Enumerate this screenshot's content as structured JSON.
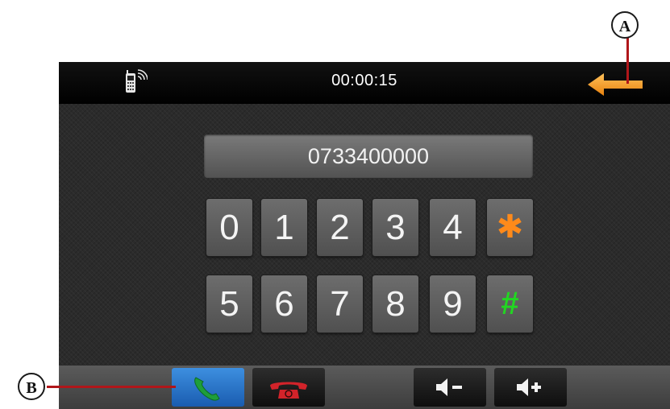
{
  "status_bar": {
    "call_timer": "00:00:15",
    "phone_icon": "phone-signal-icon",
    "back_icon": "back-arrow-icon"
  },
  "dialer": {
    "number_display": "0733400000",
    "keys_row1": [
      "0",
      "1",
      "2",
      "3",
      "4",
      "✱"
    ],
    "keys_row2": [
      "5",
      "6",
      "7",
      "8",
      "9",
      "#"
    ]
  },
  "bottom_bar": {
    "buttons": [
      "call-icon",
      "hang-up-icon",
      "volume-down-icon",
      "volume-up-icon"
    ]
  },
  "callouts": {
    "a": "A",
    "b": "B"
  },
  "colors": {
    "star_key": "#ff8a1a",
    "hash_key": "#22d622",
    "back_arrow": "#f7941d",
    "call_button": "#2a77cf",
    "call_icon": "#1e9e3a",
    "hangup_icon": "#d2232a",
    "callout_line": "#b0161a"
  }
}
